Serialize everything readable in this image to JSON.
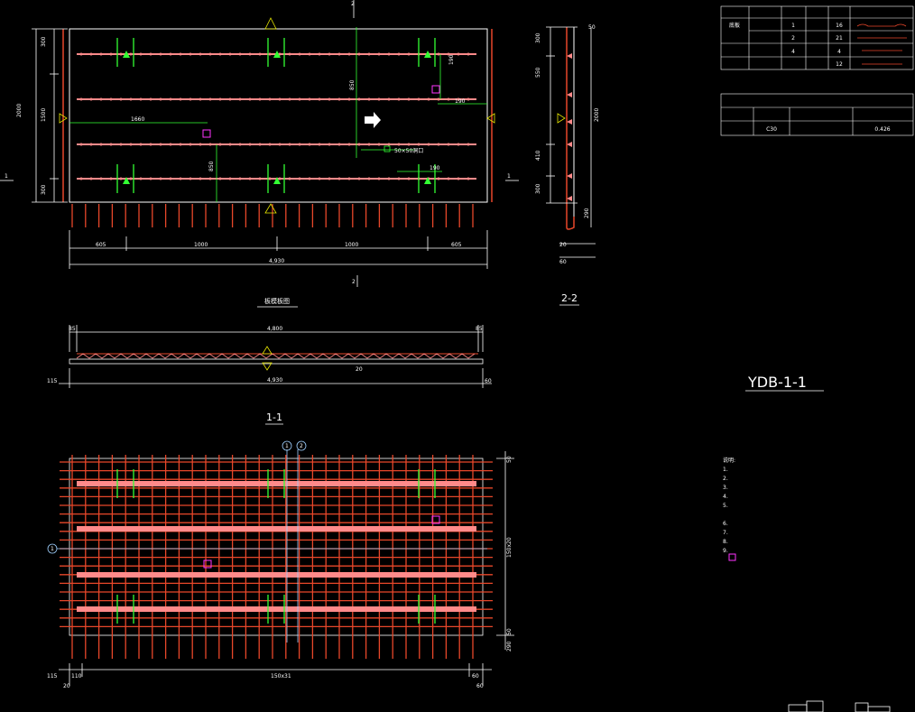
{
  "plan_view": {
    "title": "板模板图",
    "dim_total": "4,930",
    "dim_segments": [
      "605",
      "1000",
      "1000",
      "605"
    ],
    "dim_left_total": "2000",
    "dim_left_parts": [
      "300",
      "1500",
      "300"
    ],
    "label_1660": "1660",
    "label_850": "850",
    "label_850b": "850",
    "label_190": "190",
    "label_190b": "190",
    "label_5050": "50×50洞口",
    "label_2": "2",
    "label_1": "1"
  },
  "section_22": {
    "title": "2-2",
    "dims": [
      "300",
      "550",
      "410",
      "300"
    ],
    "dim_total": "2000",
    "bottom_dims": [
      "20",
      "60"
    ],
    "dims_right": [
      "50",
      "290"
    ]
  },
  "section_11": {
    "title": "1-1",
    "dim_top": "4,800",
    "dim_bottom": "4,930",
    "ends": [
      "85",
      "85",
      "115",
      "60"
    ],
    "mid": "20"
  },
  "rebar_view": {
    "dim_bottom": "150x31",
    "dim_bottom_ends": [
      "115",
      "110",
      "20",
      "60",
      "60"
    ],
    "dim_right": "150x20",
    "dim_right_ends": [
      "50",
      "50",
      "290"
    ],
    "markers": [
      "1",
      "2",
      "1"
    ]
  },
  "table_top": {
    "headers": [
      "",
      "",
      "",
      "",
      "",
      ""
    ],
    "rows": [
      [
        "底板",
        "",
        "1",
        "",
        "16",
        ""
      ],
      [
        "",
        "",
        "2",
        "",
        "21",
        ""
      ],
      [
        "",
        "",
        "4",
        "",
        "4",
        ""
      ],
      [
        "",
        "",
        "",
        "",
        "12",
        ""
      ]
    ]
  },
  "table_info": {
    "title": "",
    "headers": [
      "",
      "",
      "",
      ""
    ],
    "row": [
      "",
      "C30",
      "",
      "0.426"
    ]
  },
  "drawing_label": "YDB-1-1",
  "notes": {
    "title": "说明:",
    "lines": [
      "1.",
      "2.",
      "3.",
      "4.",
      "5.",
      "",
      "6.",
      "7.",
      "8.",
      "9."
    ]
  },
  "colors": {
    "bg": "#000000",
    "rebar": "#e8472a",
    "truss": "#ff8a8a",
    "dim": "#ffffff",
    "mark": "#33ff33",
    "yellow": "#e6e600",
    "magenta": "#ff33ff"
  }
}
